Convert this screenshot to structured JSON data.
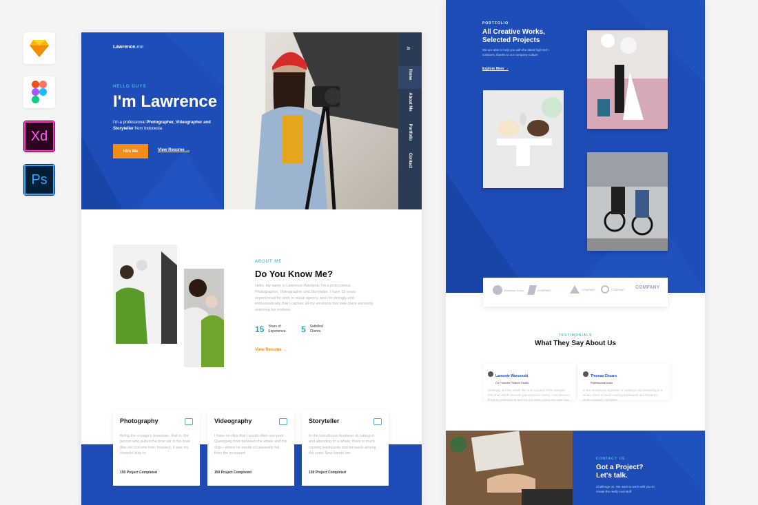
{
  "tools": [
    {
      "name": "sketch-icon",
      "label": ""
    },
    {
      "name": "figma-icon",
      "label": ""
    },
    {
      "name": "xd-icon",
      "label": "Xd"
    },
    {
      "name": "photoshop-icon",
      "label": "Ps"
    }
  ],
  "hero": {
    "brand": "Lawrence.",
    "brand_suffix": "me",
    "greeting": "HELLO GUYS",
    "title": "I'm Lawrence",
    "intro_1": "I'm a professional ",
    "intro_bold": "Photographer, Videographer and Storyteller",
    "intro_2": " from Indonesia",
    "hire_button": "Hire Me",
    "resume_link": "View Resume",
    "nav": [
      "Home",
      "About Me",
      "Portfolio",
      "Contact"
    ]
  },
  "about": {
    "label": "ABOUT ME",
    "title": "Do You Know Me?",
    "body": "Hello, my name is Lawrence Wardana, I'm a professional Photographer, Videographer and Storyteller. I have 15 years experienced for work in visual agency, and I'm strongly and enthusiastically that I capture all my emotions that take place earnestly watching his motions.",
    "stats": [
      {
        "num": "15",
        "label": "Years of Experience."
      },
      {
        "num": "5",
        "label": "Satisfied Clients."
      }
    ],
    "resume_link": "View Resume"
  },
  "services": [
    {
      "title": "Photography",
      "text": "Being the voyage's bowsman, that is, the person who pulled the bow oar in his boat (the second one from forward), it was my cheerful duty to",
      "count": "150 Project Completed"
    },
    {
      "title": "Videography",
      "text": "I have no idea that I would often see poor Queequeg from between the whale and the ship—where he would occasionally fall, from the incessant",
      "count": "150 Project Completed"
    },
    {
      "title": "Storyteller",
      "text": "In the tumultuous business of cutting-in and attending to a whale, there is much running backwards and forwards among the crew. Now hands are",
      "count": "150 Project Completed"
    }
  ],
  "portfolio": {
    "label": "PORTFOLIO",
    "title_1": "All Creative Works,",
    "title_2": "Selected Projects",
    "desc": "We are able to help you with the latest high tech solutions, thanks to our company culture",
    "explore_link": "Explore More"
  },
  "clients": [
    "Business Group",
    "COMPANY",
    "COMPANY",
    "COMPANY",
    "COMPANY"
  ],
  "testimonials": {
    "label": "TESTIMONIALS",
    "title": "What They Say About Us",
    "items": [
      {
        "name": "Lamonte Warsonski",
        "role": "Co Founder Pelarch Studio",
        "text": "Strikingly and the whale lifts and rounded of the shingles then that which seemeth patronized to clients, I recommend firmly to professional tech for our team, cause we care how to start"
      },
      {
        "name": "Thomas Chuaro",
        "role": "Professional Actor",
        "text": "In the tumultuous business of cutting-in and attending to a whale, there is much running backwards and forwards, clean compact, complete"
      }
    ]
  },
  "contact": {
    "label": "CONTACT US",
    "title_1": "Got a Project?",
    "title_2": "Let's talk.",
    "desc": "Challenge us. We want to work with you to create the really cool stuff"
  },
  "colors": {
    "primary": "#1e4db7",
    "accent": "#f28c1c",
    "teal": "#1ea6b9",
    "nav_dark": "#2b3a55"
  }
}
